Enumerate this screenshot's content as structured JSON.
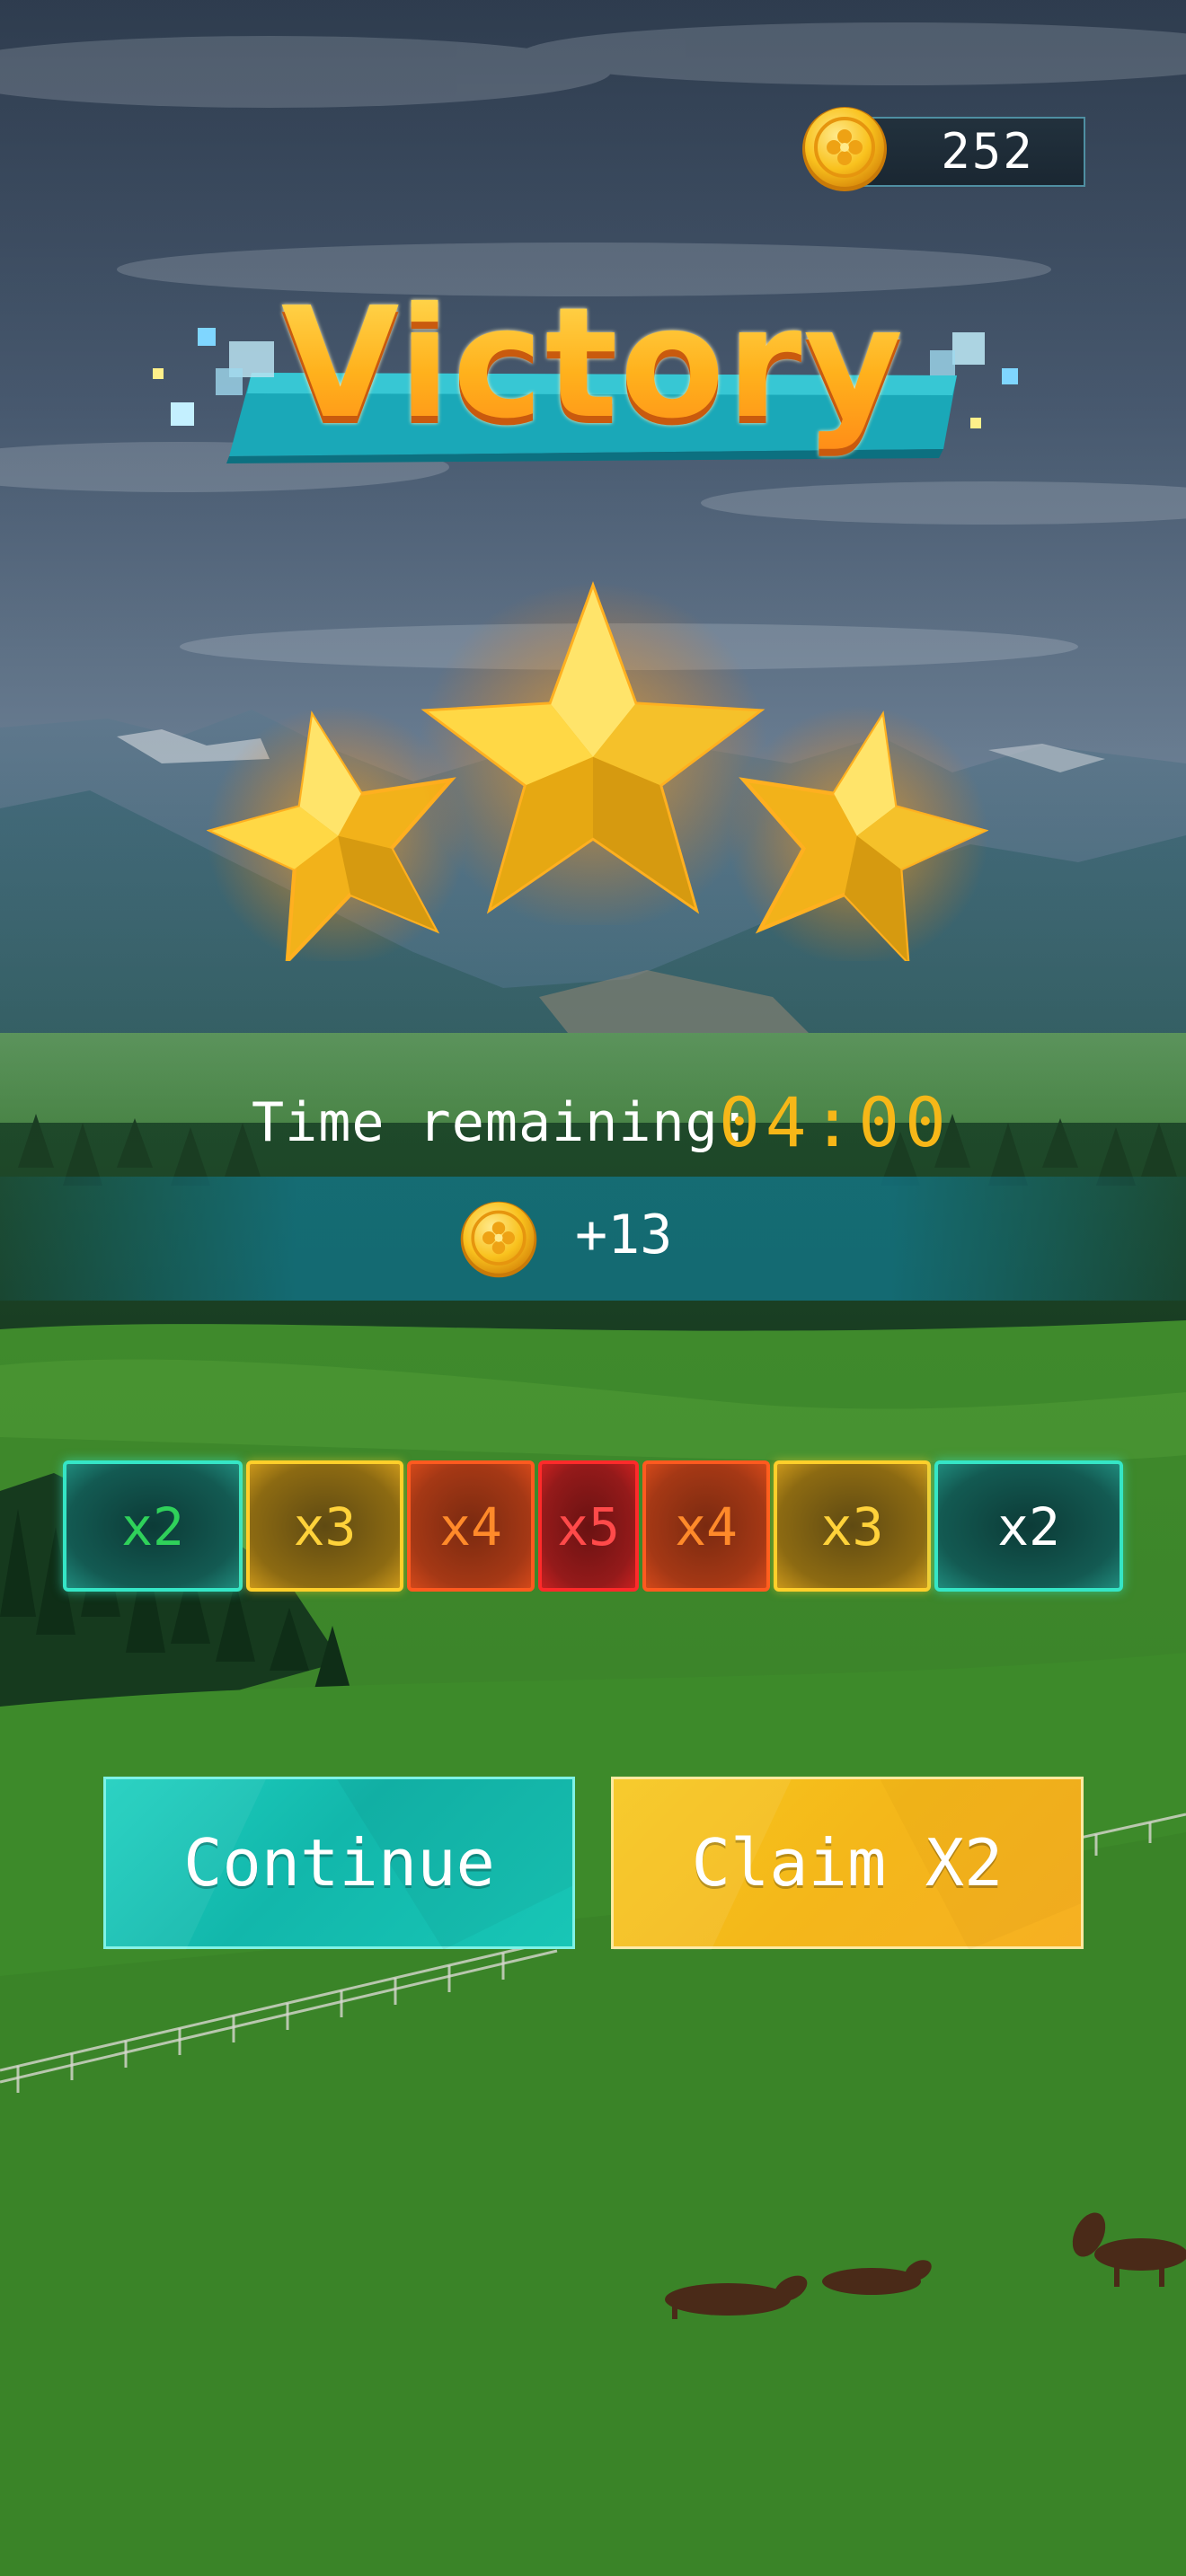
{
  "coins": {
    "balance": "252"
  },
  "title": "Victory",
  "stars": {
    "earned": 3,
    "total": 3
  },
  "time": {
    "label": "Time remaining:",
    "value": "04:00"
  },
  "reward": {
    "value": "+13"
  },
  "multipliers": [
    {
      "label": "x2",
      "tone": "teal"
    },
    {
      "label": "x3",
      "tone": "gold"
    },
    {
      "label": "x4",
      "tone": "orange"
    },
    {
      "label": "x5",
      "tone": "red"
    },
    {
      "label": "x4",
      "tone": "orange"
    },
    {
      "label": "x3",
      "tone": "gold"
    },
    {
      "label": "x2",
      "tone": "teal"
    }
  ],
  "buttons": {
    "continue": "Continue",
    "claim": "Claim X2"
  },
  "colors": {
    "accent_gold": "#f6b718",
    "accent_teal": "#1fd0c0",
    "title_orange": "#ffb01c"
  }
}
